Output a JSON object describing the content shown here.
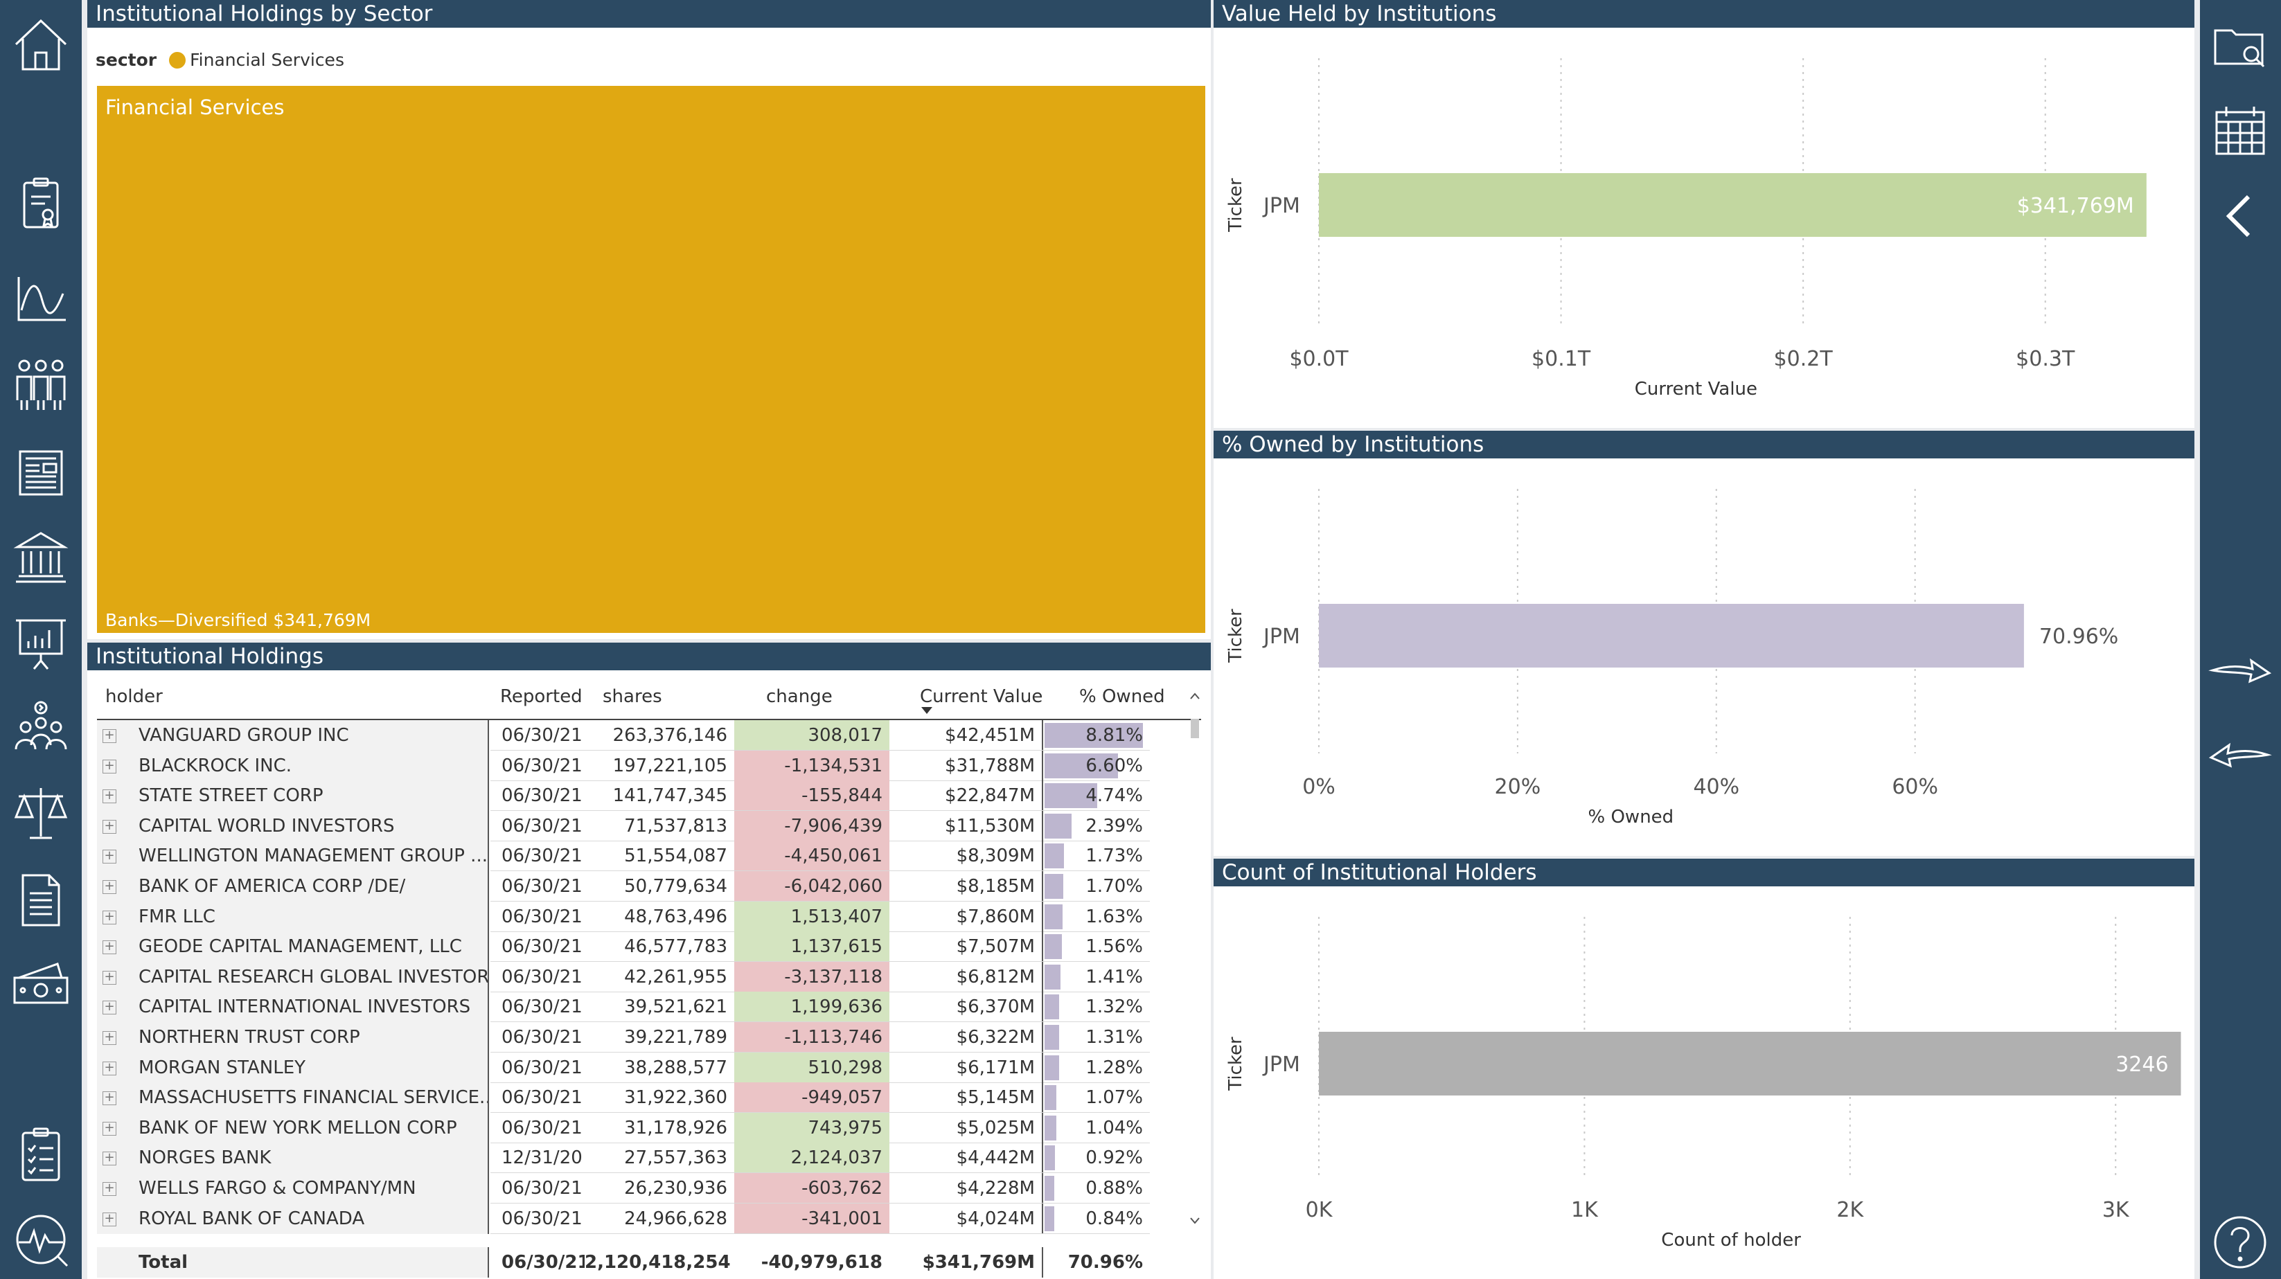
{
  "sector_panel": {
    "title": "Institutional Holdings by Sector",
    "legend_title": "sector",
    "legend_item": "Financial Services",
    "tile_label": "Financial Services",
    "tile_sublabel": "Banks—Diversified $341,769M",
    "tile_color": "#e0a812"
  },
  "table_panel": {
    "title": "Institutional Holdings",
    "columns": [
      "holder",
      "Reported",
      "shares",
      "change",
      "Current Value",
      "% Owned"
    ],
    "rows": [
      {
        "holder": "VANGUARD GROUP INC",
        "reported": "06/30/21",
        "shares": "263,376,146",
        "change": "308,017",
        "value": "$42,451M",
        "owned": "8.81%"
      },
      {
        "holder": "BLACKROCK INC.",
        "reported": "06/30/21",
        "shares": "197,221,105",
        "change": "-1,134,531",
        "value": "$31,788M",
        "owned": "6.60%"
      },
      {
        "holder": "STATE STREET CORP",
        "reported": "06/30/21",
        "shares": "141,747,345",
        "change": "-155,844",
        "value": "$22,847M",
        "owned": "4.74%"
      },
      {
        "holder": "CAPITAL WORLD INVESTORS",
        "reported": "06/30/21",
        "shares": "71,537,813",
        "change": "-7,906,439",
        "value": "$11,530M",
        "owned": "2.39%"
      },
      {
        "holder": "WELLINGTON MANAGEMENT GROUP ...",
        "reported": "06/30/21",
        "shares": "51,554,087",
        "change": "-4,450,061",
        "value": "$8,309M",
        "owned": "1.73%"
      },
      {
        "holder": "BANK OF AMERICA CORP /DE/",
        "reported": "06/30/21",
        "shares": "50,779,634",
        "change": "-6,042,060",
        "value": "$8,185M",
        "owned": "1.70%"
      },
      {
        "holder": "FMR LLC",
        "reported": "06/30/21",
        "shares": "48,763,496",
        "change": "1,513,407",
        "value": "$7,860M",
        "owned": "1.63%"
      },
      {
        "holder": "GEODE CAPITAL MANAGEMENT, LLC",
        "reported": "06/30/21",
        "shares": "46,577,783",
        "change": "1,137,615",
        "value": "$7,507M",
        "owned": "1.56%"
      },
      {
        "holder": "CAPITAL RESEARCH GLOBAL INVESTORS",
        "reported": "06/30/21",
        "shares": "42,261,955",
        "change": "-3,137,118",
        "value": "$6,812M",
        "owned": "1.41%"
      },
      {
        "holder": "CAPITAL INTERNATIONAL INVESTORS",
        "reported": "06/30/21",
        "shares": "39,521,621",
        "change": "1,199,636",
        "value": "$6,370M",
        "owned": "1.32%"
      },
      {
        "holder": "NORTHERN TRUST CORP",
        "reported": "06/30/21",
        "shares": "39,221,789",
        "change": "-1,113,746",
        "value": "$6,322M",
        "owned": "1.31%"
      },
      {
        "holder": "MORGAN STANLEY",
        "reported": "06/30/21",
        "shares": "38,288,577",
        "change": "510,298",
        "value": "$6,171M",
        "owned": "1.28%"
      },
      {
        "holder": "MASSACHUSETTS FINANCIAL SERVICE...",
        "reported": "06/30/21",
        "shares": "31,922,360",
        "change": "-949,057",
        "value": "$5,145M",
        "owned": "1.07%"
      },
      {
        "holder": "BANK OF NEW YORK MELLON CORP",
        "reported": "06/30/21",
        "shares": "31,178,926",
        "change": "743,975",
        "value": "$5,025M",
        "owned": "1.04%"
      },
      {
        "holder": "NORGES BANK",
        "reported": "12/31/20",
        "shares": "27,557,363",
        "change": "2,124,037",
        "value": "$4,442M",
        "owned": "0.92%"
      },
      {
        "holder": "WELLS FARGO & COMPANY/MN",
        "reported": "06/30/21",
        "shares": "26,230,936",
        "change": "-603,762",
        "value": "$4,228M",
        "owned": "0.88%"
      },
      {
        "holder": "ROYAL BANK OF CANADA",
        "reported": "06/30/21",
        "shares": "24,966,628",
        "change": "-341,001",
        "value": "$4,024M",
        "owned": "0.84%"
      }
    ],
    "owned_fractions": [
      0.0881,
      0.066,
      0.0474,
      0.0239,
      0.0173,
      0.017,
      0.0163,
      0.0156,
      0.0141,
      0.0132,
      0.0131,
      0.0128,
      0.0107,
      0.0104,
      0.0092,
      0.0088,
      0.0084
    ],
    "total": {
      "label": "Total",
      "reported": "06/30/21",
      "shares": "2,120,418,254",
      "change": "-40,979,618",
      "value": "$341,769M",
      "owned": "70.96%"
    },
    "positive_color": "#d4e4c0",
    "negative_color": "#ebc4c6",
    "owned_bar_color": "#bdb6cf"
  },
  "chart_data": [
    {
      "type": "bar",
      "title": "Value Held by Institutions",
      "categories": [
        "JPM"
      ],
      "values": [
        341769
      ],
      "data_labels": [
        "$341,769M"
      ],
      "ticks": [
        0,
        100000,
        200000,
        300000
      ],
      "tick_labels": [
        "$0.0T",
        "$0.1T",
        "$0.2T",
        "$0.3T"
      ],
      "xlim": [
        0,
        357000
      ],
      "xlabel": "Current Value",
      "ylabel": "Ticker",
      "color": "#c2d7a0",
      "label_inside": true
    },
    {
      "type": "bar",
      "title": "% Owned by Institutions",
      "categories": [
        "JPM"
      ],
      "values": [
        70.96
      ],
      "data_labels": [
        "70.96%"
      ],
      "ticks": [
        0,
        20,
        40,
        60
      ],
      "tick_labels": [
        "0%",
        "20%",
        "40%",
        "60%"
      ],
      "xlim": [
        0,
        87
      ],
      "xlabel": "% Owned",
      "ylabel": "Ticker",
      "color": "#c5bfd5",
      "label_inside": false
    },
    {
      "type": "bar",
      "title": "Count of Institutional Holders",
      "categories": [
        "JPM"
      ],
      "values": [
        3246
      ],
      "data_labels": [
        "3246"
      ],
      "ticks": [
        0,
        1000,
        2000,
        3000
      ],
      "tick_labels": [
        "0K",
        "1K",
        "2K",
        "3K"
      ],
      "xlim": [
        0,
        3255
      ],
      "xlabel": "Count of holder",
      "ylabel": "Ticker",
      "color": "#b0b0b0",
      "label_inside": true
    }
  ],
  "left_nav": [
    {
      "name": "home-icon"
    },
    {
      "name": "certificate-icon"
    },
    {
      "name": "line-chart-icon"
    },
    {
      "name": "people-group-icon"
    },
    {
      "name": "news-icon"
    },
    {
      "name": "bank-icon"
    },
    {
      "name": "presentation-icon"
    },
    {
      "name": "team-idea-icon"
    },
    {
      "name": "scales-icon"
    },
    {
      "name": "document-icon"
    },
    {
      "name": "money-icon"
    },
    {
      "name": "checklist-icon"
    },
    {
      "name": "health-monitor-icon"
    }
  ],
  "right_nav": [
    {
      "name": "folder-search-icon"
    },
    {
      "name": "calendar-icon"
    },
    {
      "name": "collapse-chevron-icon"
    },
    {
      "name": "forward-arrow-icon"
    },
    {
      "name": "back-arrow-icon"
    },
    {
      "name": "help-icon"
    }
  ],
  "colors": {
    "nav": "#2c4a63",
    "header": "#2c4a63",
    "background": "#e9ebee"
  }
}
